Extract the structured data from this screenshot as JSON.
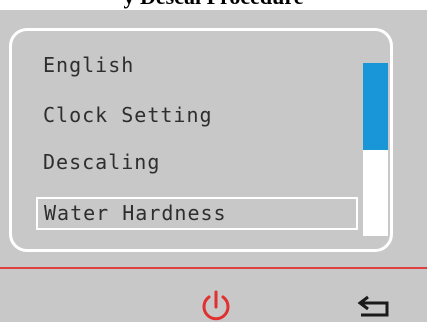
{
  "header": {
    "title": "y Descal Procedure"
  },
  "menu": {
    "items": [
      {
        "label": "English"
      },
      {
        "label": "Clock Setting"
      },
      {
        "label": "Descaling"
      },
      {
        "label": "Water Hardness"
      }
    ],
    "selected_index": 3,
    "scroll_fraction_visible": 0.5
  },
  "footer": {
    "power_icon": "power-icon",
    "back_icon": "back-arrow-icon"
  },
  "colors": {
    "background": "#c8c8c8",
    "accent": "#1996d8",
    "divider": "#e04040",
    "power": "#e03030"
  }
}
